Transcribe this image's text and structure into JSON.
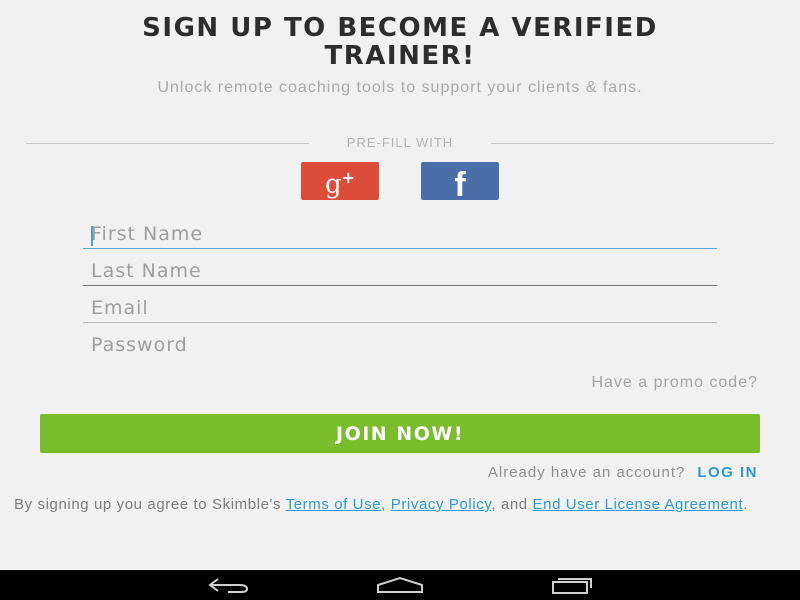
{
  "header": {
    "title": "SIGN UP TO BECOME A VERIFIED\nTRAINER!",
    "subtitle": "Unlock remote coaching tools to support your clients & fans."
  },
  "prefill": {
    "label": "PRE-FILL WITH",
    "google_icon": "google-plus-icon",
    "facebook_icon": "facebook-icon",
    "google_color": "#dd4b39",
    "facebook_color": "#4a6ea9"
  },
  "form": {
    "first_name_placeholder": "First Name",
    "last_name_placeholder": "Last Name",
    "email_placeholder": "Email",
    "password_placeholder": "Password",
    "promo_link": "Have a promo code?",
    "join_label": "JOIN NOW!",
    "join_color": "#79bc2c"
  },
  "login": {
    "prompt": "Already have an account?",
    "link": "LOG IN"
  },
  "legal": {
    "prefix": "By signing up you agree to Skimble's ",
    "terms": "Terms of Use",
    "sep1": ", ",
    "privacy": "Privacy Policy",
    "sep2": ", and ",
    "eula": "End User License Agreement",
    "suffix": ".",
    "link_color": "#2d9ad6"
  },
  "navbar": {
    "back_icon": "back-icon",
    "home_icon": "home-icon",
    "recents_icon": "recents-icon"
  }
}
